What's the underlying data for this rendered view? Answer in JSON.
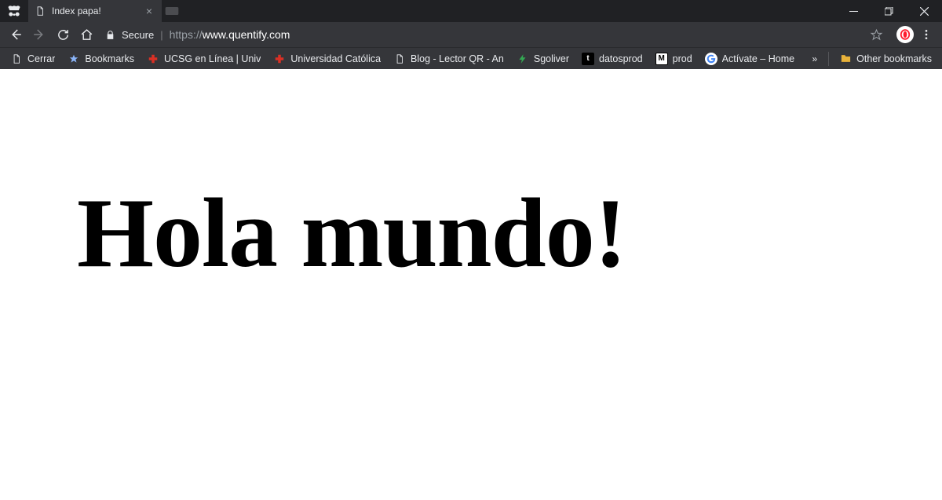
{
  "tab": {
    "title": "Index papa!",
    "close_glyph": "×"
  },
  "window": {
    "minimize": "—",
    "maximize": "❐",
    "close": "✕"
  },
  "toolbar": {
    "secure_label": "Secure",
    "separator": "|",
    "url_scheme": "https://",
    "url_host": "www.quentify.com"
  },
  "bookmarks": {
    "items": [
      {
        "label": "Cerrar",
        "icon": "doc"
      },
      {
        "label": "Bookmarks",
        "icon": "star"
      },
      {
        "label": "UCSG en Línea | Univ",
        "icon": "redcross"
      },
      {
        "label": "Universidad Católica",
        "icon": "redcross"
      },
      {
        "label": "Blog - Lector QR - An",
        "icon": "doc"
      },
      {
        "label": "Sgoliver",
        "icon": "greens"
      },
      {
        "label": "datosprod",
        "icon": "tbox"
      },
      {
        "label": "prod",
        "icon": "mbox"
      },
      {
        "label": "Actívate – Home",
        "icon": "google"
      }
    ],
    "overflow": "»",
    "other": "Other bookmarks"
  },
  "page": {
    "heading": "Hola mundo!"
  }
}
